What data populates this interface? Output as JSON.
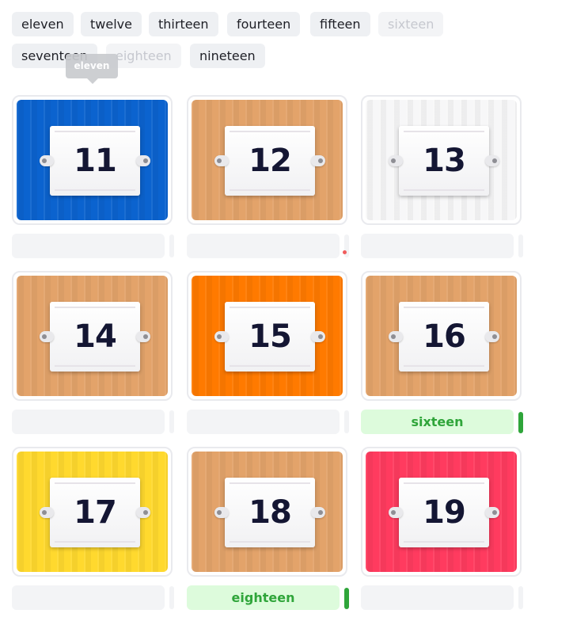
{
  "word_bank": {
    "chips": [
      {
        "label": "eleven",
        "used": false
      },
      {
        "label": "twelve",
        "used": false
      },
      {
        "label": "thirteen",
        "used": false
      },
      {
        "label": "fourteen",
        "used": false
      },
      {
        "label": "fifteen",
        "used": false
      },
      {
        "label": "sixteen",
        "used": true
      },
      {
        "label": "seventeen",
        "used": false
      },
      {
        "label": "eighteen",
        "used": true
      },
      {
        "label": "nineteen",
        "used": false
      }
    ],
    "tooltip": "eleven"
  },
  "cards": [
    {
      "number": "11",
      "color": "#0b63cf",
      "answer": "",
      "status": "empty"
    },
    {
      "number": "12",
      "color": "#e3a36a",
      "answer": "",
      "status": "empty"
    },
    {
      "number": "13",
      "color": "#f7f7f8",
      "answer": "",
      "status": "empty"
    },
    {
      "number": "14",
      "color": "#e3a36a",
      "answer": "",
      "status": "empty"
    },
    {
      "number": "15",
      "color": "#ff7a00",
      "answer": "",
      "status": "empty"
    },
    {
      "number": "16",
      "color": "#e3a36a",
      "answer": "sixteen",
      "status": "correct"
    },
    {
      "number": "17",
      "color": "#ffd92e",
      "answer": "",
      "status": "empty"
    },
    {
      "number": "18",
      "color": "#e3a36a",
      "answer": "eighteen",
      "status": "correct"
    },
    {
      "number": "19",
      "color": "#ff3b5f",
      "answer": "",
      "status": "empty"
    }
  ]
}
